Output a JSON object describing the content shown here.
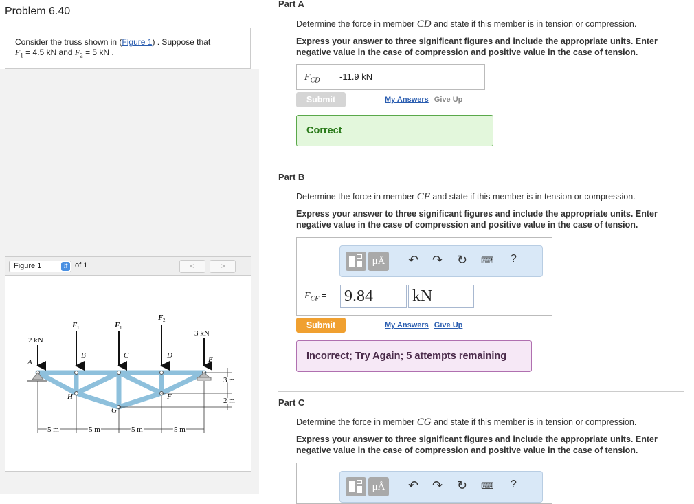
{
  "problem": {
    "title": "Problem 6.40",
    "text_before_link": "Consider the truss shown in (",
    "figure_link": "Figure 1",
    "text_after_link": ") . Suppose that",
    "f1_label": "F",
    "f1_sub": "1",
    "f1_value": " = 4.5  kN and ",
    "f2_label": "F",
    "f2_sub": "2",
    "f2_value": " = 5  kN ."
  },
  "figure_nav": {
    "select_value": "Figure 1",
    "of_text": "of 1",
    "prev": "<",
    "next": ">"
  },
  "figure": {
    "loads": {
      "left": "2 kN",
      "F1a": "F",
      "F1b": "F",
      "F2": "F",
      "right": "3 kN",
      "sub1": "1",
      "sub2": "2"
    },
    "nodes": {
      "A": "A",
      "B": "B",
      "C": "C",
      "D": "D",
      "E": "E",
      "F": "F",
      "G": "G",
      "H": "H"
    },
    "dims": {
      "d1": "5 m",
      "d2": "5 m",
      "d3": "5 m",
      "d4": "5 m",
      "h1": "3 m",
      "h2": "2 m"
    }
  },
  "partA": {
    "title": "Part A",
    "question_pre": "Determine the force in member ",
    "member": "CD",
    "question_post": " and state if this member is in tension or compression.",
    "instructions": "Express your answer to three significant figures and include the appropriate units. Enter negative value in the case of compression and positive value in the case of tension.",
    "label_var": "F",
    "label_sub": "CD",
    "equals": " =",
    "answer": "-11.9 kN",
    "submit": "Submit",
    "my_answers": "My Answers",
    "give_up": "Give Up",
    "feedback": "Correct"
  },
  "partB": {
    "title": "Part B",
    "question_pre": "Determine the force in member ",
    "member": "CF",
    "question_post": " and state if this member is in tension or compression.",
    "instructions": "Express your answer to three significant figures and include the appropriate units. Enter negative value in the case of compression and positive value in the case of tension.",
    "label_var": "F",
    "label_sub": "CF",
    "equals": " =",
    "value": "9.84",
    "units": "kN",
    "submit": "Submit",
    "my_answers": "My Answers",
    "give_up": "Give Up",
    "feedback": "Incorrect; Try Again; 5 attempts remaining",
    "toolbar": {
      "mu_label": "μÅ",
      "help": "?"
    }
  },
  "partC": {
    "title": "Part C",
    "question_pre": "Determine the force in member ",
    "member": "CG",
    "question_post": " and state if this member is in tension or compression.",
    "instructions": "Express your answer to three significant figures and include the appropriate units. Enter negative value in the case of compression and positive value in the case of tension.",
    "toolbar": {
      "mu_label": "μÅ",
      "help": "?"
    }
  },
  "colors": {
    "truss": "#8ec0dc",
    "submit_active": "#f0a030",
    "submit_disabled": "#d5d5d5",
    "correct_bg": "#e3f7dc",
    "correct_border": "#5aa84a",
    "correct_text": "#2a7a1a",
    "incorrect_bg": "#f6e8f6",
    "incorrect_border": "#b070b0",
    "incorrect_text": "#4a2a4a",
    "link": "#2a5db0"
  }
}
